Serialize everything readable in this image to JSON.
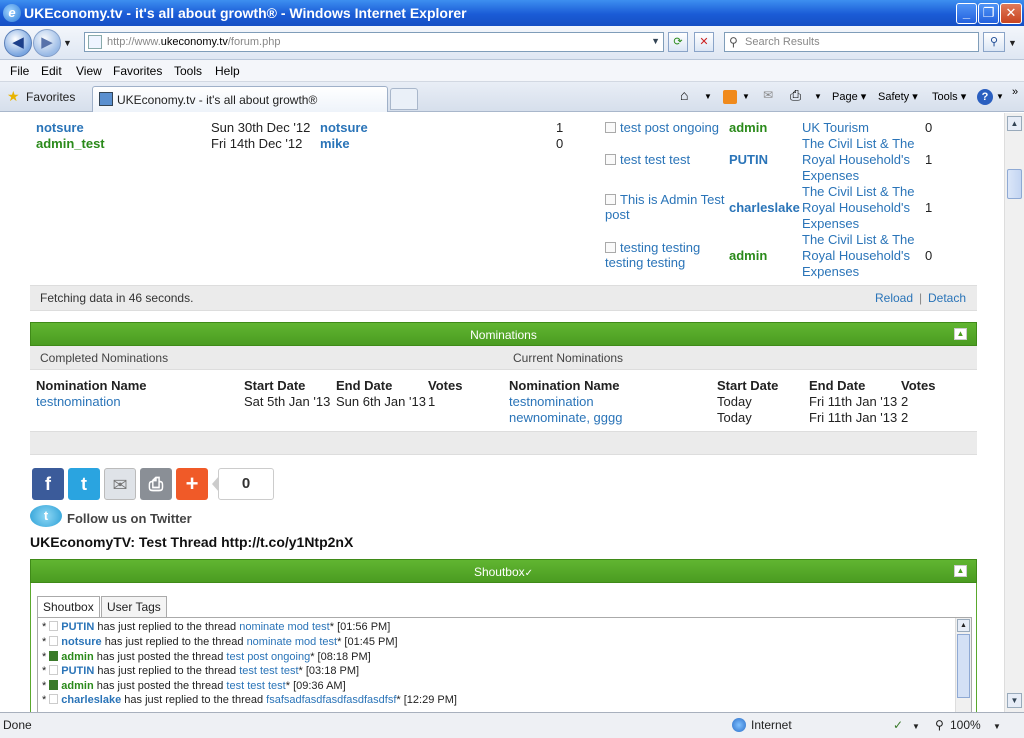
{
  "window": {
    "title": "UKEconomy.tv - it's all about growth® - Windows Internet Explorer",
    "ie_logo": "e",
    "buttons": {
      "minimize": "_",
      "maximize": "❐",
      "close": "✕"
    }
  },
  "address": {
    "url_prefix": "http://www.",
    "url_domain": "ukeconomy.tv",
    "url_suffix": "/forum.php",
    "search_placeholder": "Search Results"
  },
  "menu": [
    "File",
    "Edit",
    "View",
    "Favorites",
    "Tools",
    "Help"
  ],
  "tabs": {
    "favorites_label": "Favorites",
    "active_tab": "UKEconomy.tv - it's all about growth®"
  },
  "toolbar": {
    "page": "Page ▾",
    "safety": "Safety ▾",
    "tools": "Tools ▾"
  },
  "stats": {
    "rows": [
      {
        "user": "notsure",
        "user_color": "blue",
        "date": "Sun 30th Dec '12",
        "last_user": "notsure",
        "count": "1"
      },
      {
        "user": "admin_test",
        "user_color": "green",
        "date": "Fri 14th Dec '12",
        "last_user": "mike",
        "count": "0"
      }
    ],
    "threads": [
      {
        "title": "test post ongoing",
        "poster": "admin",
        "poster_color": "green",
        "forum": "UK Tourism",
        "replies": "0"
      },
      {
        "title": "test test test",
        "poster": "PUTIN",
        "poster_color": "blue",
        "forum": "The Civil List & The Royal Household's Expenses",
        "replies": "1"
      },
      {
        "title": "This is Admin Test post",
        "poster": "charleslake",
        "poster_color": "blue",
        "forum": "The Civil List & The Royal Household's Expenses",
        "replies": "1"
      },
      {
        "title": "testing testing testing testing",
        "poster": "admin",
        "poster_color": "green",
        "forum": "The Civil List & The Royal Household's Expenses",
        "replies": "0"
      }
    ],
    "fetching": "Fetching data in 46 seconds.",
    "reload": "Reload",
    "separator": "|",
    "detach": "Detach"
  },
  "nominations": {
    "header": "Nominations",
    "completed_title": "Completed Nominations",
    "current_title": "Current Nominations",
    "columns": {
      "name": "Nomination Name",
      "start": "Start Date",
      "end": "End Date",
      "votes": "Votes"
    },
    "completed": [
      {
        "name": "testnomination",
        "start": "Sat 5th Jan '13",
        "end": "Sun 6th Jan '13",
        "votes": "1"
      }
    ],
    "current": [
      {
        "name": "testnomination",
        "start": "Today",
        "end": "Fri 11th Jan '13",
        "votes": "2"
      },
      {
        "name": "newnominate, gggg",
        "start": "Today",
        "end": "Fri 11th Jan '13",
        "votes": "2"
      }
    ]
  },
  "share": {
    "count": "0",
    "icons": [
      "facebook-icon",
      "twitter-icon",
      "email-icon",
      "print-icon",
      "addthis-icon"
    ]
  },
  "twitter": {
    "follow": "Follow us on Twitter",
    "tweet": "UKEconomyTV: Test Thread http://t.co/y1Ntp2nX"
  },
  "shoutbox": {
    "header": "Shoutbox",
    "tabs": [
      "Shoutbox",
      "User Tags"
    ],
    "lines": [
      {
        "user": "PUTIN",
        "action": "has just replied to the thread",
        "thread": "nominate mod test",
        "time": "[01:56 PM]",
        "avatar": "blank"
      },
      {
        "user": "notsure",
        "action": "has just replied to the thread",
        "thread": "nominate mod test",
        "time": "[01:45 PM]",
        "avatar": "blank"
      },
      {
        "user": "admin",
        "action": "has just posted the thread",
        "thread": "test post ongoing",
        "time": "[08:18 PM]",
        "avatar": "green"
      },
      {
        "user": "PUTIN",
        "action": "has just replied to the thread",
        "thread": "test test test",
        "time": "[03:18 PM]",
        "avatar": "blank"
      },
      {
        "user": "admin",
        "action": "has just posted the thread",
        "thread": "test test test",
        "time": "[09:36 AM]",
        "avatar": "green"
      },
      {
        "user": "charleslake",
        "action": "has just replied to the thread",
        "thread": "fsafsadfasdfasdfasdfasdfsf",
        "time": "[12:29 PM]",
        "avatar": "blank"
      }
    ]
  },
  "status": {
    "left": "Done",
    "zone": "Internet",
    "zoom": "100%"
  },
  "colors": {
    "accent_green": "#4b9c21",
    "link_blue": "#2a74b8",
    "user_green": "#2a8a1a"
  }
}
